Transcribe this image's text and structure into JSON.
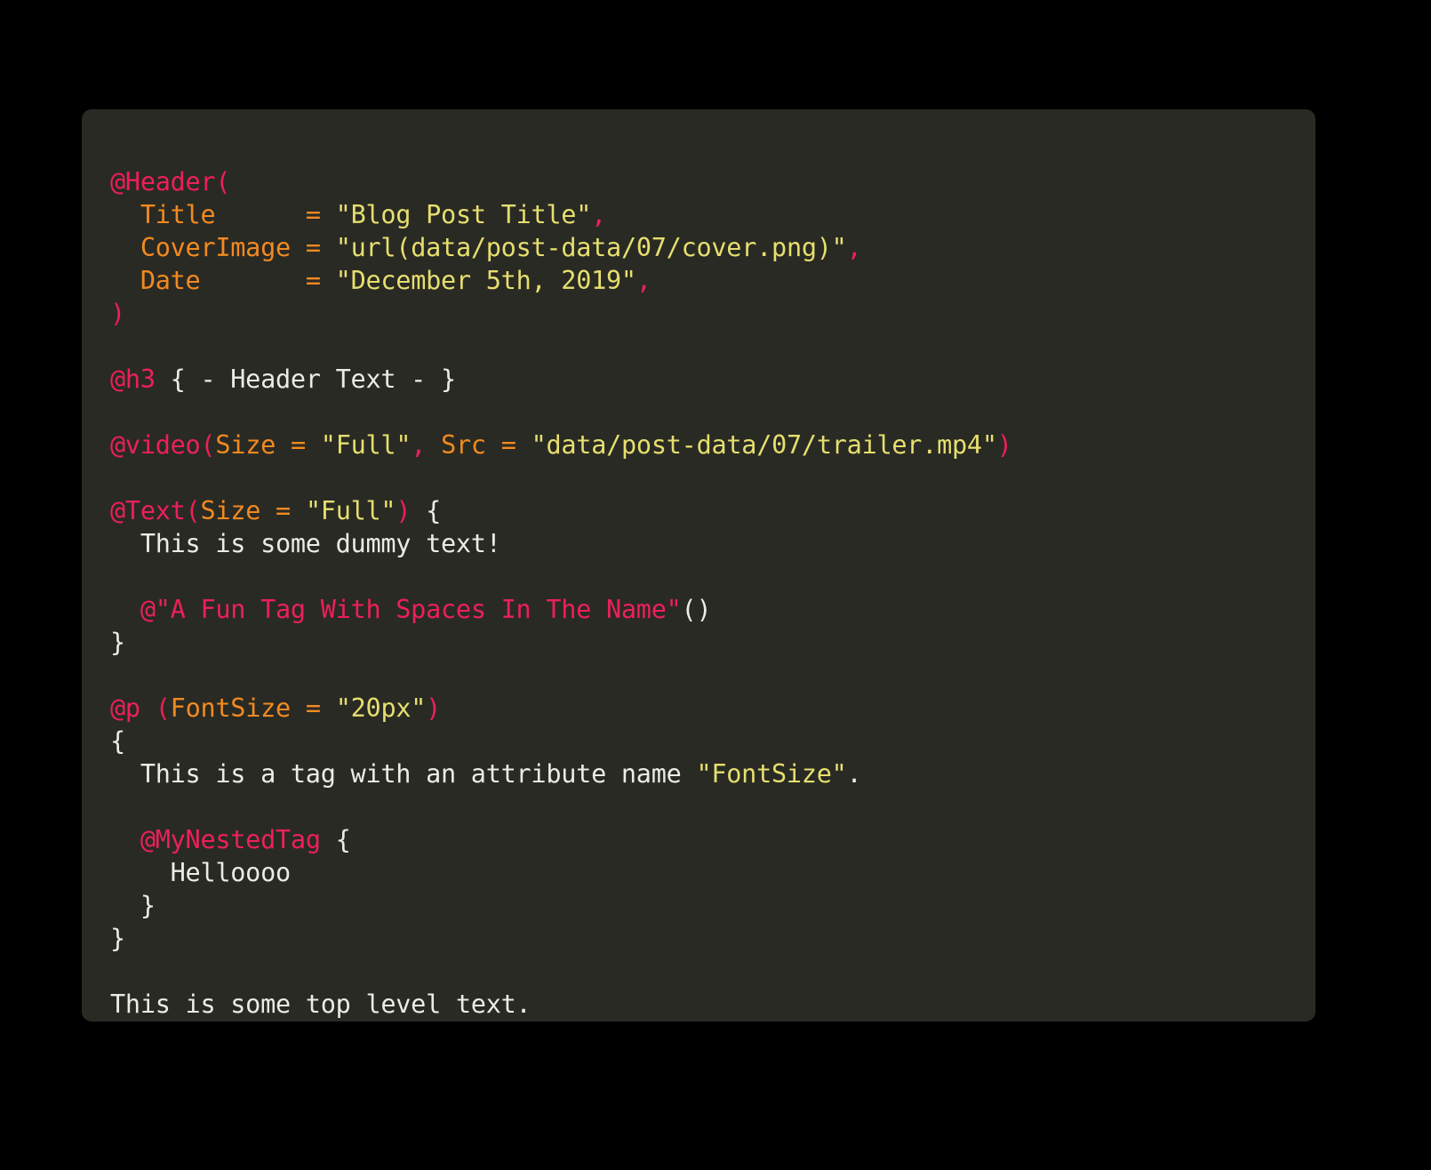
{
  "theme": {
    "page_background": "#000000",
    "card_background": "#2a2a24",
    "tag_color": "#ec2059",
    "attribute_color": "#f28a20",
    "string_color": "#e6df6e",
    "text_color": "#ecece6"
  },
  "code": {
    "language": "chapter-markup",
    "lines": [
      {
        "id": "l01",
        "segments": [
          {
            "t": "@Header(",
            "c": "tag"
          }
        ]
      },
      {
        "id": "l02",
        "segments": [
          {
            "t": "  ",
            "c": "text"
          },
          {
            "t": "Title",
            "c": "attr"
          },
          {
            "t": "      ",
            "c": "text"
          },
          {
            "t": "=",
            "c": "eq"
          },
          {
            "t": " ",
            "c": "text"
          },
          {
            "t": "\"Blog Post Title\"",
            "c": "str"
          },
          {
            "t": ",",
            "c": "punct"
          }
        ]
      },
      {
        "id": "l03",
        "segments": [
          {
            "t": "  ",
            "c": "text"
          },
          {
            "t": "CoverImage",
            "c": "attr"
          },
          {
            "t": " ",
            "c": "text"
          },
          {
            "t": "=",
            "c": "eq"
          },
          {
            "t": " ",
            "c": "text"
          },
          {
            "t": "\"url(data/post-data/07/cover.png)\"",
            "c": "str"
          },
          {
            "t": ",",
            "c": "punct"
          }
        ]
      },
      {
        "id": "l04",
        "segments": [
          {
            "t": "  ",
            "c": "text"
          },
          {
            "t": "Date",
            "c": "attr"
          },
          {
            "t": "       ",
            "c": "text"
          },
          {
            "t": "=",
            "c": "eq"
          },
          {
            "t": " ",
            "c": "text"
          },
          {
            "t": "\"December 5th, 2019\"",
            "c": "str"
          },
          {
            "t": ",",
            "c": "punct"
          }
        ]
      },
      {
        "id": "l05",
        "segments": [
          {
            "t": ")",
            "c": "tag"
          }
        ]
      },
      {
        "id": "l06",
        "segments": []
      },
      {
        "id": "l07",
        "segments": [
          {
            "t": "@h3",
            "c": "tag"
          },
          {
            "t": " { - Header Text - }",
            "c": "text"
          }
        ]
      },
      {
        "id": "l08",
        "segments": []
      },
      {
        "id": "l09",
        "segments": [
          {
            "t": "@video",
            "c": "tag"
          },
          {
            "t": "(",
            "c": "punct"
          },
          {
            "t": "Size",
            "c": "attr"
          },
          {
            "t": " ",
            "c": "text"
          },
          {
            "t": "=",
            "c": "eq"
          },
          {
            "t": " ",
            "c": "text"
          },
          {
            "t": "\"Full\"",
            "c": "str"
          },
          {
            "t": ",",
            "c": "punct"
          },
          {
            "t": " ",
            "c": "text"
          },
          {
            "t": "Src",
            "c": "attr"
          },
          {
            "t": " ",
            "c": "text"
          },
          {
            "t": "=",
            "c": "eq"
          },
          {
            "t": " ",
            "c": "text"
          },
          {
            "t": "\"data/post-data/07/trailer.mp4\"",
            "c": "str"
          },
          {
            "t": ")",
            "c": "punct"
          }
        ]
      },
      {
        "id": "l10",
        "segments": []
      },
      {
        "id": "l11",
        "segments": [
          {
            "t": "@Text",
            "c": "tag"
          },
          {
            "t": "(",
            "c": "punct"
          },
          {
            "t": "Size",
            "c": "attr"
          },
          {
            "t": " ",
            "c": "text"
          },
          {
            "t": "=",
            "c": "eq"
          },
          {
            "t": " ",
            "c": "text"
          },
          {
            "t": "\"Full\"",
            "c": "str"
          },
          {
            "t": ")",
            "c": "punct"
          },
          {
            "t": " {",
            "c": "text"
          }
        ]
      },
      {
        "id": "l12",
        "segments": [
          {
            "t": "  This is some dummy text!",
            "c": "text"
          }
        ]
      },
      {
        "id": "l13",
        "segments": []
      },
      {
        "id": "l14",
        "segments": [
          {
            "t": "  ",
            "c": "text"
          },
          {
            "t": "@\"A Fun Tag With Spaces In The Name\"",
            "c": "tag"
          },
          {
            "t": "()",
            "c": "text"
          }
        ]
      },
      {
        "id": "l15",
        "segments": [
          {
            "t": "}",
            "c": "text"
          }
        ]
      },
      {
        "id": "l16",
        "segments": []
      },
      {
        "id": "l17",
        "segments": [
          {
            "t": "@p",
            "c": "tag"
          },
          {
            "t": " ",
            "c": "text"
          },
          {
            "t": "(",
            "c": "punct"
          },
          {
            "t": "FontSize",
            "c": "attr"
          },
          {
            "t": " ",
            "c": "text"
          },
          {
            "t": "=",
            "c": "eq"
          },
          {
            "t": " ",
            "c": "text"
          },
          {
            "t": "\"20px\"",
            "c": "str"
          },
          {
            "t": ")",
            "c": "punct"
          }
        ]
      },
      {
        "id": "l18",
        "segments": [
          {
            "t": "{",
            "c": "text"
          }
        ]
      },
      {
        "id": "l19",
        "segments": [
          {
            "t": "  This is a tag with an attribute name ",
            "c": "text"
          },
          {
            "t": "\"FontSize\"",
            "c": "str"
          },
          {
            "t": ".",
            "c": "text"
          }
        ]
      },
      {
        "id": "l20",
        "segments": []
      },
      {
        "id": "l21",
        "segments": [
          {
            "t": "  ",
            "c": "text"
          },
          {
            "t": "@MyNestedTag",
            "c": "tag"
          },
          {
            "t": " {",
            "c": "text"
          }
        ]
      },
      {
        "id": "l22",
        "segments": [
          {
            "t": "    Helloooo",
            "c": "text"
          }
        ]
      },
      {
        "id": "l23",
        "segments": [
          {
            "t": "  }",
            "c": "text"
          }
        ]
      },
      {
        "id": "l24",
        "segments": [
          {
            "t": "}",
            "c": "text"
          }
        ]
      },
      {
        "id": "l25",
        "segments": []
      },
      {
        "id": "l26",
        "segments": [
          {
            "t": "This is some top level text.",
            "c": "text"
          }
        ]
      }
    ],
    "plain_text": "@Header(\n  Title      = \"Blog Post Title\",\n  CoverImage = \"url(data/post-data/07/cover.png)\",\n  Date       = \"December 5th, 2019\",\n)\n\n@h3 { - Header Text - }\n\n@video(Size = \"Full\", Src = \"data/post-data/07/trailer.mp4\")\n\n@Text(Size = \"Full\") {\n  This is some dummy text!\n\n  @\"A Fun Tag With Spaces In The Name\"()\n}\n\n@p (FontSize = \"20px\")\n{\n  This is a tag with an attribute name \"FontSize\".\n\n  @MyNestedTag {\n    Helloooo\n  }\n}\n\nThis is some top level text."
  }
}
